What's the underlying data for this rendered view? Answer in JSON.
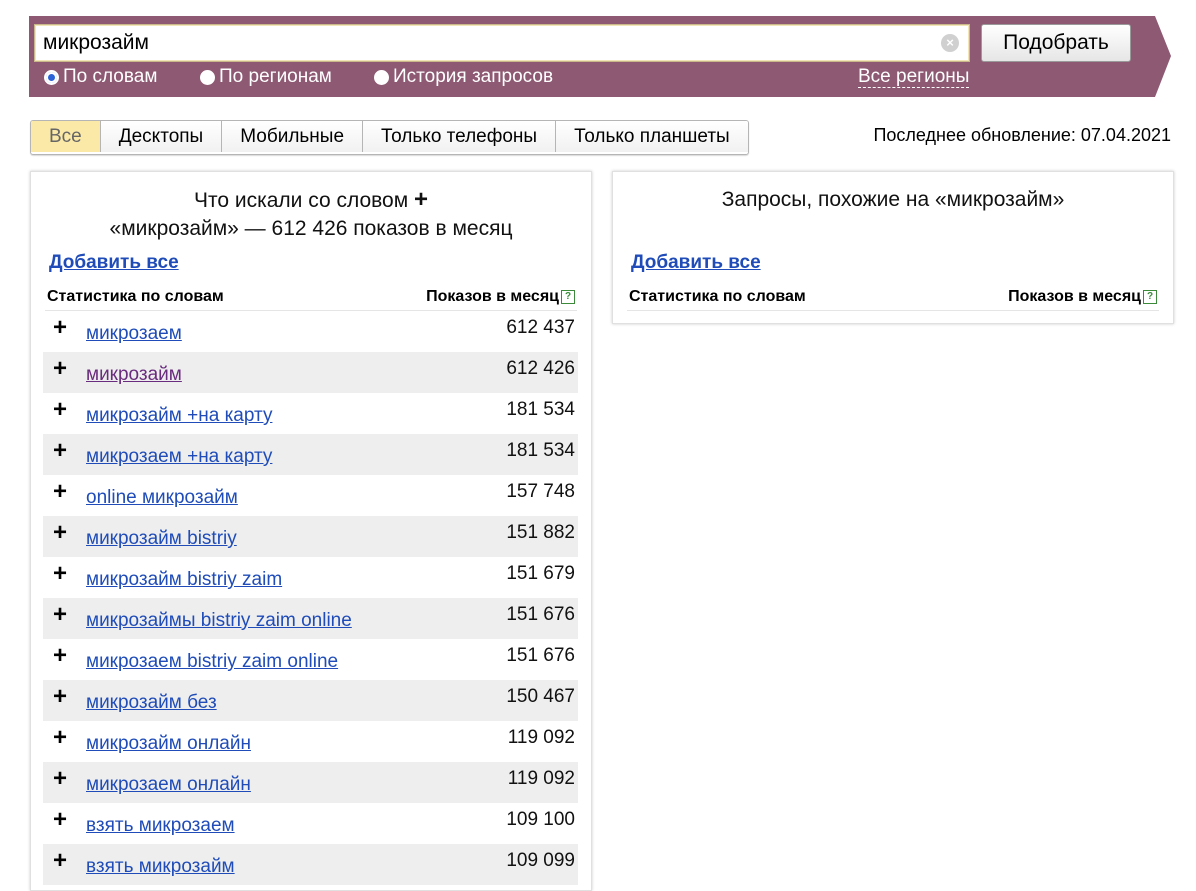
{
  "search": {
    "query": "микрозайм",
    "submit_label": "Подобрать",
    "clear_icon": "×",
    "modes": [
      "По словам",
      "По регионам",
      "История запросов"
    ],
    "selected_mode": 0,
    "regions_link": "Все регионы"
  },
  "tabs": [
    "Все",
    "Десктопы",
    "Мобильные",
    "Только телефоны",
    "Только планшеты"
  ],
  "active_tab": 0,
  "last_update": "Последнее обновление: 07.04.2021",
  "left_panel": {
    "title_line1": "Что искали со словом",
    "title_plus": "+",
    "title_line2": "«микрозайм» — 612 426 показов в месяц",
    "add_all": "Добавить все",
    "col_left": "Статистика по словам",
    "col_right": "Показов в месяц",
    "help": "?",
    "rows": [
      {
        "kw": "микрозаем",
        "count": "612 437"
      },
      {
        "kw": "микрозайм",
        "count": "612 426"
      },
      {
        "kw": "микрозайм +на карту",
        "count": "181 534"
      },
      {
        "kw": "микрозаем +на карту",
        "count": "181 534"
      },
      {
        "kw": "online микрозайм",
        "count": "157 748"
      },
      {
        "kw": "микрозайм bistriy",
        "count": "151 882"
      },
      {
        "kw": "микрозайм bistriy zaim",
        "count": "151 679"
      },
      {
        "kw": "микрозаймы bistriy zaim online",
        "count": "151 676"
      },
      {
        "kw": "микрозаем bistriy zaim online",
        "count": "151 676"
      },
      {
        "kw": "микрозайм без",
        "count": "150 467"
      },
      {
        "kw": "микрозайм онлайн",
        "count": "119 092"
      },
      {
        "kw": "микрозаем онлайн",
        "count": "119 092"
      },
      {
        "kw": "взять микрозаем",
        "count": "109 100"
      },
      {
        "kw": "взять микрозайм",
        "count": "109 099"
      }
    ]
  },
  "right_panel": {
    "title": "Запросы, похожие на «микрозайм»",
    "add_all": "Добавить все",
    "col_left": "Статистика по словам",
    "col_right": "Показов в месяц",
    "help": "?"
  },
  "colors": {
    "banner": "#8e5a73",
    "link": "#1f4cb8",
    "visited_link": "#6a2c7e",
    "active_tab": "#fbeaa7",
    "row_alt": "#eeeeee"
  }
}
